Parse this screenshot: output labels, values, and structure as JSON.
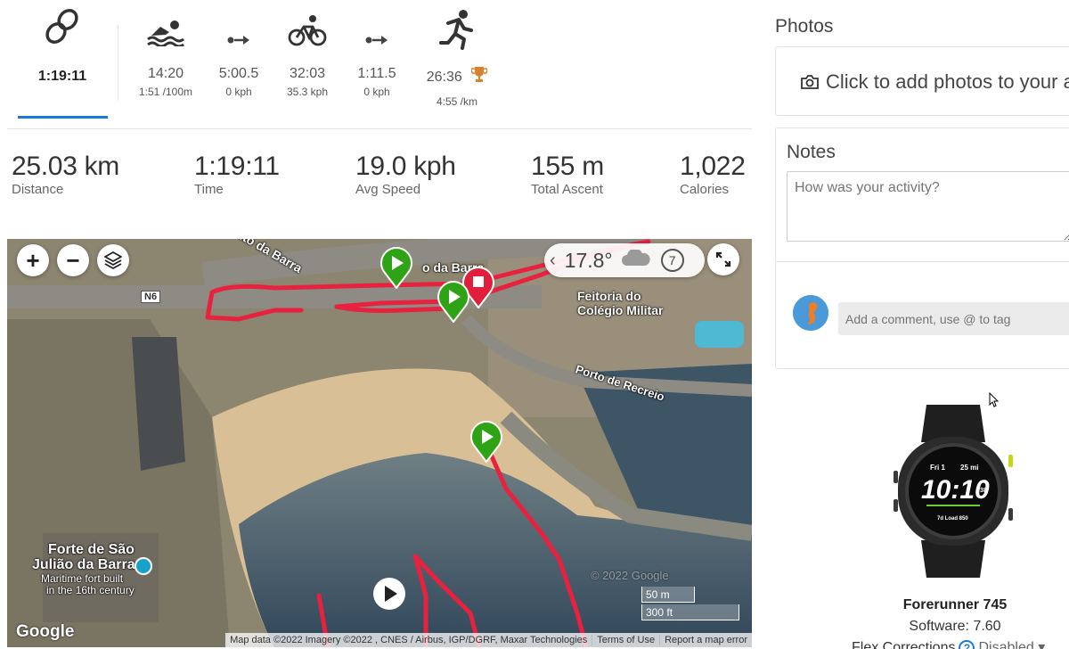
{
  "segments": [
    {
      "icon": "multisport-rings-icon",
      "main": "1:19:11",
      "sub": ""
    },
    {
      "icon": "swim-icon",
      "main": "14:20",
      "sub": "1:51 /100m"
    },
    {
      "icon": "transition-icon",
      "main": "5:00.5",
      "sub": "0 kph"
    },
    {
      "icon": "bike-icon",
      "main": "32:03",
      "sub": "35.3 kph"
    },
    {
      "icon": "transition-icon",
      "main": "1:11.5",
      "sub": "0 kph"
    },
    {
      "icon": "run-icon",
      "main": "26:36",
      "sub": "4:55 /km"
    }
  ],
  "stats": [
    {
      "value": "25.03 km",
      "label": "Distance"
    },
    {
      "value": "1:19:11",
      "label": "Time"
    },
    {
      "value": "19.0 kph",
      "label": "Avg Speed"
    },
    {
      "value": "155 m",
      "label": "Total Ascent"
    },
    {
      "value": "1,022",
      "label": "Calories"
    }
  ],
  "map": {
    "weather_temp": "17.8°",
    "wind_value": "7",
    "labels": {
      "alto_da_barra": "Alto da Barra",
      "o_da_barra": "o da Barra",
      "n6": "N6",
      "feitoria_1": "Feitoria do",
      "feitoria_2": "Colégio Militar",
      "porto": "Porto de Recreio",
      "forte_1": "Forte de São",
      "forte_2": "Julião da Barra",
      "forte_3": "Maritime fort built",
      "forte_4": "in the 16th century",
      "watermark": "© 2022 Google"
    },
    "scale_m": "50 m",
    "scale_ft": "300 ft",
    "google": "Google",
    "attribution": "Map data ©2022 Imagery ©2022 , CNES / Airbus, IGP/DGRF, Maxar Technologies",
    "terms": "Terms of Use",
    "report": "Report a map error"
  },
  "photos": {
    "title": "Photos",
    "prompt": "Click to add photos to your ac"
  },
  "notes": {
    "title": "Notes",
    "placeholder": "How was your activity?"
  },
  "comment": {
    "placeholder": "Add a comment, use @ to tag"
  },
  "watch_face": {
    "date": "Fri 1",
    "distance": "25 mi",
    "time": "10:10",
    "seconds": "38",
    "load": "7d Load 850"
  },
  "device": {
    "name": "Forerunner 745",
    "software": "Software: 7.60",
    "flex_label": "Flex Corrections",
    "flex_value": "Disabled"
  },
  "colors": {
    "accent": "#1a7bd6",
    "track": "#e8213f",
    "start_marker": "#2ea316",
    "stop_marker": "#e0203a",
    "trophy": "#d9822b"
  }
}
